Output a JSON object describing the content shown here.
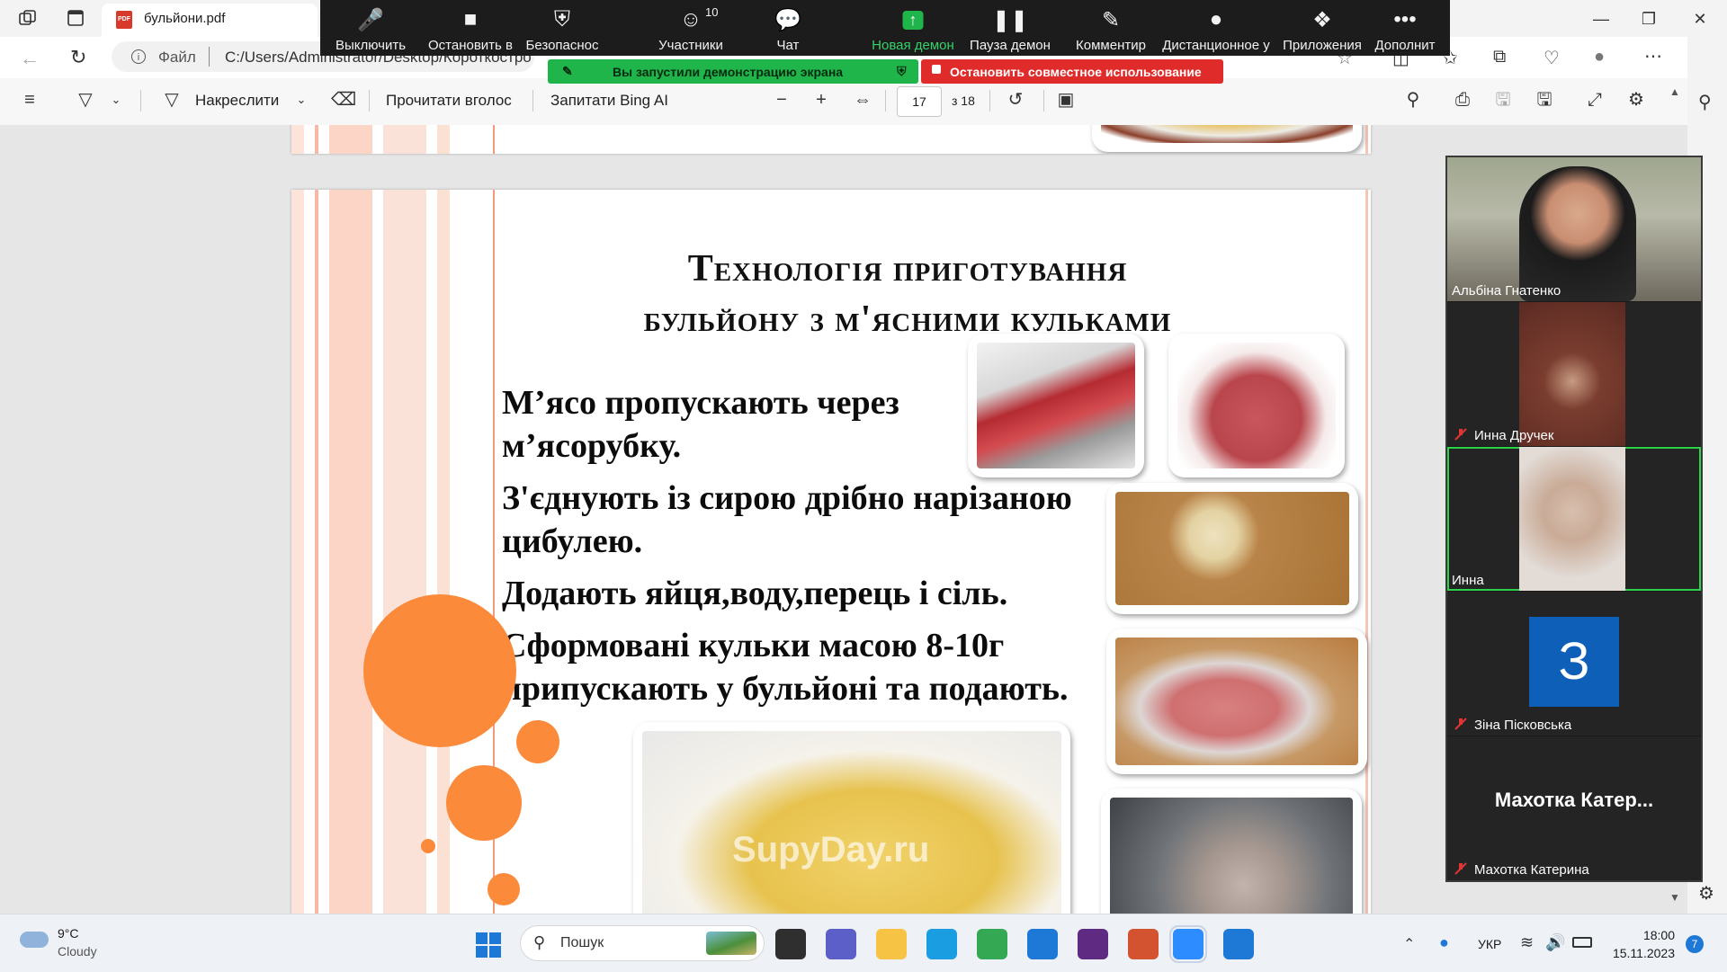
{
  "browser": {
    "tab_title": "бульйони.pdf",
    "address_protocol": "Файл",
    "address_path": "C:/Users/Administrator/Desktop/Короткостро"
  },
  "pdf_toolbar": {
    "draw_label": "Накреслити",
    "read_aloud_label": "Прочитати вголос",
    "ask_bing_label": "Запитати Bing AI",
    "page_number": "17",
    "page_total": "з 18"
  },
  "zoom_bar": {
    "items": [
      {
        "label": "Выключить",
        "icon": "microphone-icon"
      },
      {
        "label": "Остановить в",
        "icon": "video-camera-icon"
      },
      {
        "label": "Безопаснос",
        "icon": "shield-icon"
      },
      {
        "label": "Участники",
        "icon": "participants-icon",
        "count": "10"
      },
      {
        "label": "Чат",
        "icon": "chat-icon"
      },
      {
        "label": "Новая демон",
        "icon": "share-screen-icon"
      },
      {
        "label": "Пауза демон",
        "icon": "pause-icon"
      },
      {
        "label": "Комментир",
        "icon": "pencil-icon"
      },
      {
        "label": "Дистанционное у",
        "icon": "mouse-icon"
      },
      {
        "label": "Приложения",
        "icon": "apps-icon"
      },
      {
        "label": "Дополнит",
        "icon": "more-icon"
      }
    ],
    "sharing_notice": "Вы запустили демонстрацию экрана",
    "stop_sharing_label": "Остановить совместное использование",
    "colors": {
      "green": "#20b54a",
      "red": "#e02b2b"
    }
  },
  "slide": {
    "title_line1": "Технологія приготування",
    "title_line2": "бульйону з м'ясними кульками",
    "para1_line1": "М’ясо пропускають через",
    "para1_line2": "м’ясорубку.",
    "para2_line1": "З'єднують із сирою дрібно нарізаною",
    "para2_line2": "цибулею.",
    "para3": "Додають яйця,воду,перець і сіль.",
    "para4_line1": "Сформовані кульки масою 8-10г",
    "para4_line2": "припускають у бульйоні та подають.",
    "watermark": "SupyDay.ru",
    "accent_color": "#fb8a3a"
  },
  "gallery": {
    "participants": [
      {
        "name": "Альбіна Гнатенко",
        "muted": false
      },
      {
        "name": "Инна Дручек",
        "muted": true
      },
      {
        "name": "Инна",
        "muted": false
      },
      {
        "name": "Зіна Пісковська",
        "muted": true,
        "avatar_letter": "З"
      },
      {
        "name": "Махотка Катерина",
        "muted": true,
        "display_big": "Махотка  Катер..."
      }
    ]
  },
  "taskbar": {
    "weather_temp": "9°C",
    "weather_desc": "Cloudy",
    "search_placeholder": "Пошук",
    "language": "УКР",
    "time": "18:00",
    "date": "15.11.2023",
    "notification_count": "7"
  }
}
